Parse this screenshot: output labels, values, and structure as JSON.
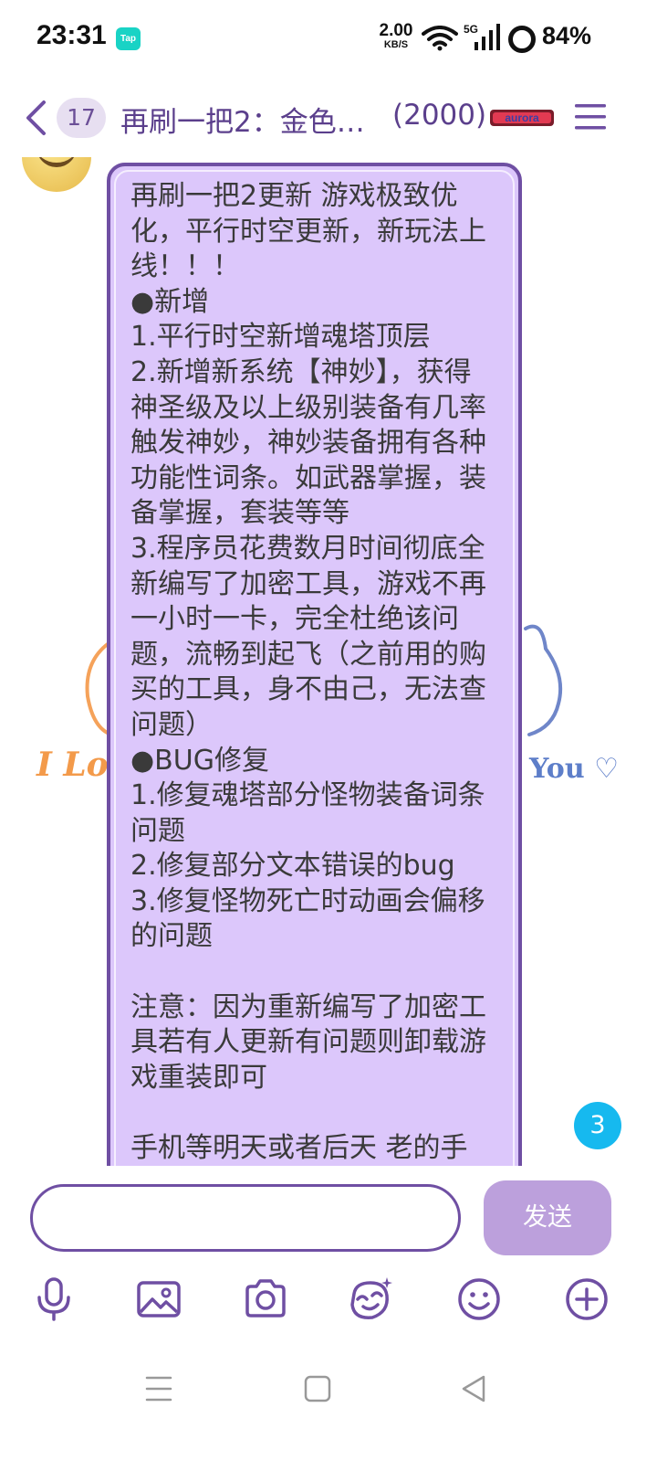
{
  "status_bar": {
    "time": "23:31",
    "tap_label": "Tap",
    "net_speed_value": "2.00",
    "net_speed_unit": "KB/S",
    "signal_label": "5G",
    "battery_percent": "84%"
  },
  "header": {
    "unread_count": "17",
    "chat_title": "再刷一把2：金色…",
    "member_count": "(2000)",
    "logo_text": "aurora"
  },
  "background": {
    "left_text": "I Lo",
    "right_text": "You ♡"
  },
  "message": {
    "text": "再刷一把2更新 游戏极致优化，平行时空更新，新玩法上线！！！\n●新增\n1.平行时空新增魂塔顶层\n2.新增新系统【神妙】，获得神圣级及以上级别装备有几率触发神妙，神妙装备拥有各种功能性词条。如武器掌握，装备掌握，套装等等\n3.程序员花费数月时间彻底全新编写了加密工具，游戏不再一小时一卡，完全杜绝该问题，流畅到起飞（之前用的购买的工具，身不由己，无法查问题）\n●BUG修复\n1.修复魂塔部分怪物装备词条问题\n2.修复部分文本错误的bug\n3.修复怪物死亡时动画会偏移的问题\n\n注意：因为重新编写了加密工具若有人更新有问题则卸载游戏重装即可\n\n手机等明天或者后天 老的手"
  },
  "unread_new": "3",
  "input": {
    "value": "",
    "placeholder": "",
    "send_label": "发送"
  },
  "colors": {
    "accent": "#6f4fa3",
    "bubble": "#dcc7fb",
    "badge": "#16b9ef"
  }
}
